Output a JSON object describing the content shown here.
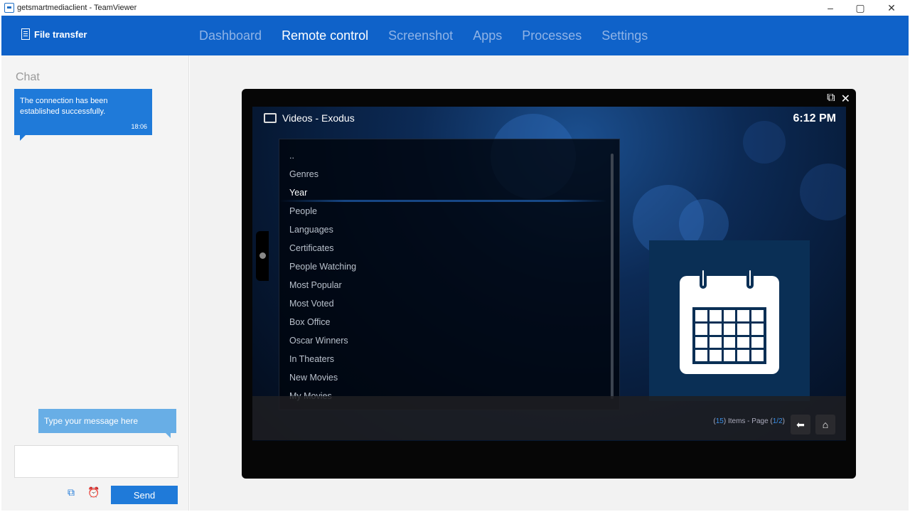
{
  "window": {
    "title": "getsmartmediaclient - TeamViewer",
    "minimize": "–",
    "maximize": "▢",
    "close": "✕"
  },
  "header": {
    "file_transfer": "File transfer",
    "tabs": [
      "Dashboard",
      "Remote control",
      "Screenshot",
      "Apps",
      "Processes",
      "Settings"
    ],
    "active_tab": "Remote control"
  },
  "chat": {
    "title": "Chat",
    "message": "The connection has been established successfully.",
    "message_time": "18:06",
    "input_placeholder": "Type your message here",
    "send_label": "Send"
  },
  "remote": {
    "title": "Videos - Exodus",
    "time": "6:12 PM",
    "items": [
      "..",
      "Genres",
      "Year",
      "People",
      "Languages",
      "Certificates",
      "People Watching",
      "Most Popular",
      "Most Voted",
      "Box Office",
      "Oscar Winners",
      "In Theaters",
      "New Movies",
      "My Movies"
    ],
    "selected_item": "Year",
    "count_prefix": "(",
    "count_total": "15",
    "count_mid": ") Items - Page (",
    "count_page": "1/2",
    "count_suffix": ")"
  },
  "colors": {
    "brand": "#0f62c9",
    "chat_bubble": "#1f7ad9",
    "hint": "#68aee6"
  }
}
